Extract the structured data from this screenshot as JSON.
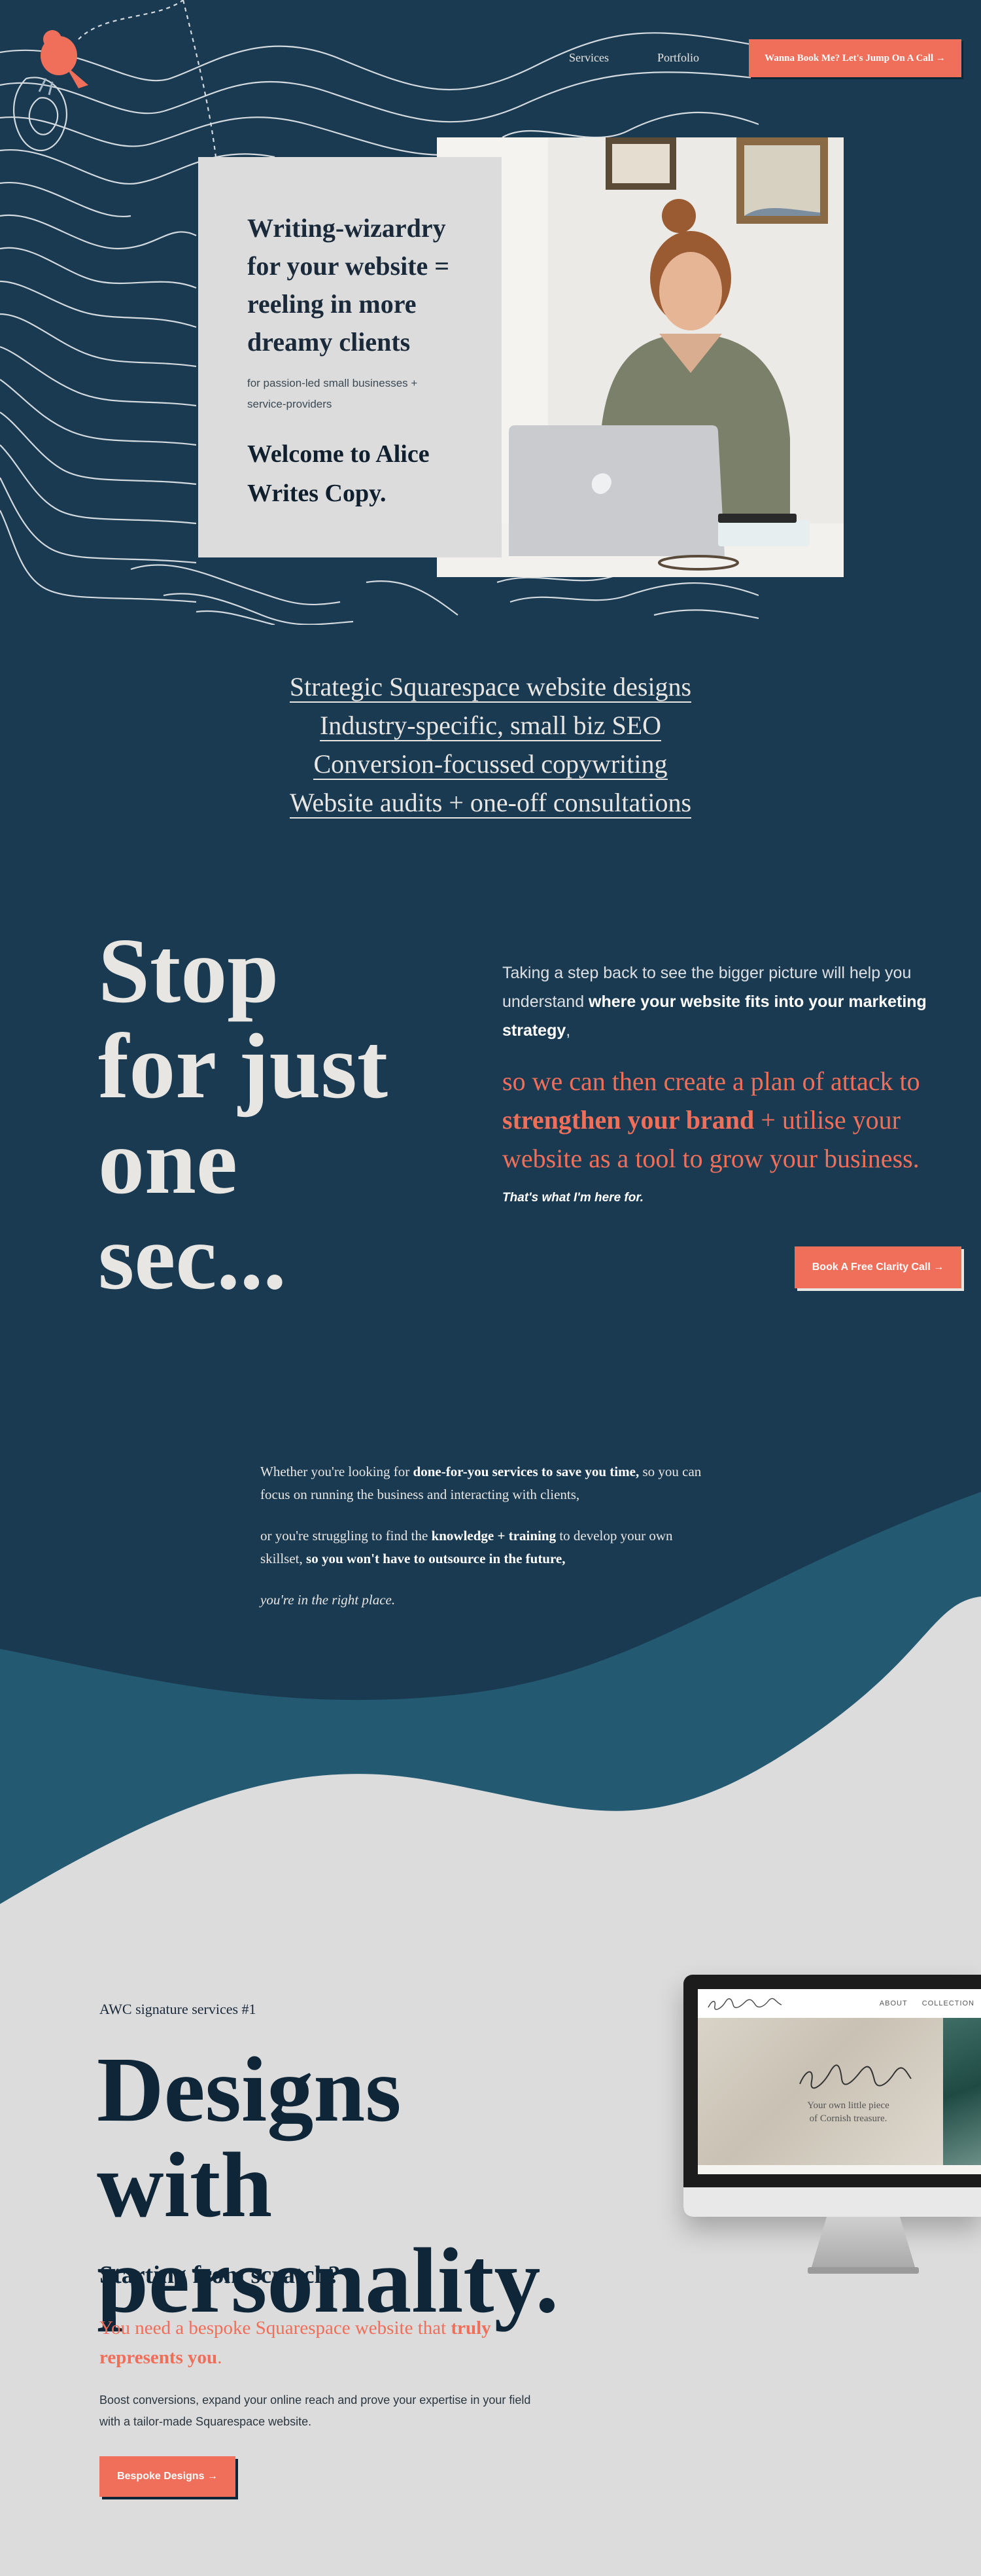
{
  "nav": {
    "services": "Services",
    "portfolio": "Portfolio",
    "cta": "Wanna Book Me? Let's Jump On A Call →"
  },
  "hero": {
    "headline": "Writing-wizardry for your website = reeling in more dreamy clients",
    "subline": "for passion-led small businesses + service-providers",
    "welcome": "Welcome to Alice Writes Copy."
  },
  "services": [
    "Strategic Squarespace website designs",
    "Industry-specific, small biz SEO",
    "Conversion-focussed copywriting",
    "Website audits + one-off consultations"
  ],
  "stop": {
    "title": "Stop for just one sec...",
    "intro_plain": "Taking a step back to see the bigger picture will help you understand ",
    "intro_bold": "where your website fits into your marketing strategy",
    "intro_end": ",",
    "coral_1": "so we can then create a plan of attack to ",
    "coral_bold": "strengthen your brand",
    "coral_2": " + utilise your website as a tool to grow your business.",
    "here": "That's what I'm here for.",
    "button": "Book A Free Clarity Call →"
  },
  "intro": {
    "p1_a": "Whether you're looking for ",
    "p1_b": "done-for-you services to save you time,",
    "p1_c": " so you can focus on running the business and interacting with clients,",
    "p2_a": "or you're struggling to find the ",
    "p2_b": "knowledge + training",
    "p2_c": " to develop your own skillset, ",
    "p2_d": "so you won't have to outsource in the future,",
    "p3": "you're in the right place."
  },
  "signature": {
    "kicker": "AWC signature services #1",
    "title": "Designs with personality.",
    "subtitle": "Starting from scratch?",
    "coral_a": "You need a bespoke Squarespace website that ",
    "coral_b": "truly represents you",
    "coral_c": ".",
    "body": "Boost conversions, expand your online reach and prove your expertise in your field with a tailor-made Squarespace website.",
    "button": "Bespoke Designs →"
  },
  "monitor": {
    "nav_about": "ABOUT",
    "nav_collections": "COLLECTION",
    "tagline": "Your own little piece of Cornish treasure."
  },
  "colors": {
    "navy": "#1a3a52",
    "coral": "#ef6f5a",
    "grey": "#dcdcdc",
    "teal_wave": "#235a72"
  }
}
